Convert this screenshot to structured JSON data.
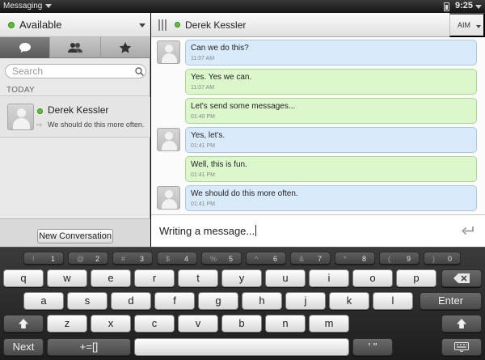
{
  "statusbar": {
    "app_name": "Messaging",
    "time": "9:25"
  },
  "left": {
    "status_label": "Available",
    "tabs": [
      {
        "name": "conversations",
        "icon": "chat-bubble-icon",
        "active": true
      },
      {
        "name": "buddies",
        "icon": "buddies-icon",
        "active": false
      },
      {
        "name": "favorites",
        "icon": "star-icon",
        "active": false
      }
    ],
    "search_placeholder": "Search",
    "section_label": "TODAY",
    "conversations": [
      {
        "name": "Derek Kessler",
        "preview": "We should do this more often.",
        "presence": "available"
      }
    ],
    "new_conversation_label": "New Conversation"
  },
  "chat": {
    "contact_name": "Derek Kessler",
    "service_label": "AIM",
    "messages": [
      {
        "text": "Can we do this?",
        "time": "11:07 AM",
        "direction": "incoming"
      },
      {
        "text": "Yes. Yes we can.",
        "time": "11:07 AM",
        "direction": "outgoing"
      },
      {
        "text": "Let's send some messages...",
        "time": "01:40 PM",
        "direction": "outgoing"
      },
      {
        "text": "Yes, let's.",
        "time": "01:41 PM",
        "direction": "incoming"
      },
      {
        "text": "Well, this is fun.",
        "time": "01:41 PM",
        "direction": "outgoing"
      },
      {
        "text": "We should do this more often.",
        "time": "01:41 PM",
        "direction": "incoming"
      }
    ],
    "draft": "Writing a message..."
  },
  "keyboard": {
    "number_row": [
      {
        "sym": "!",
        "digit": "1"
      },
      {
        "sym": "@",
        "digit": "2"
      },
      {
        "sym": "#",
        "digit": "3"
      },
      {
        "sym": "$",
        "digit": "4"
      },
      {
        "sym": "%",
        "digit": "5"
      },
      {
        "sym": "^",
        "digit": "6"
      },
      {
        "sym": "&",
        "digit": "7"
      },
      {
        "sym": "*",
        "digit": "8"
      },
      {
        "sym": "(",
        "digit": "9"
      },
      {
        "sym": ")",
        "digit": "0"
      }
    ],
    "row1": [
      "q",
      "w",
      "e",
      "r",
      "t",
      "y",
      "u",
      "i",
      "o",
      "p"
    ],
    "row2": [
      "a",
      "s",
      "d",
      "f",
      "g",
      "h",
      "j",
      "k",
      "l"
    ],
    "row3": [
      "z",
      "x",
      "c",
      "v",
      "b",
      "n",
      "m"
    ],
    "enter_label": "Enter",
    "next_label": "Next",
    "symbols_label": "+=[]",
    "quote_label": "' \""
  }
}
